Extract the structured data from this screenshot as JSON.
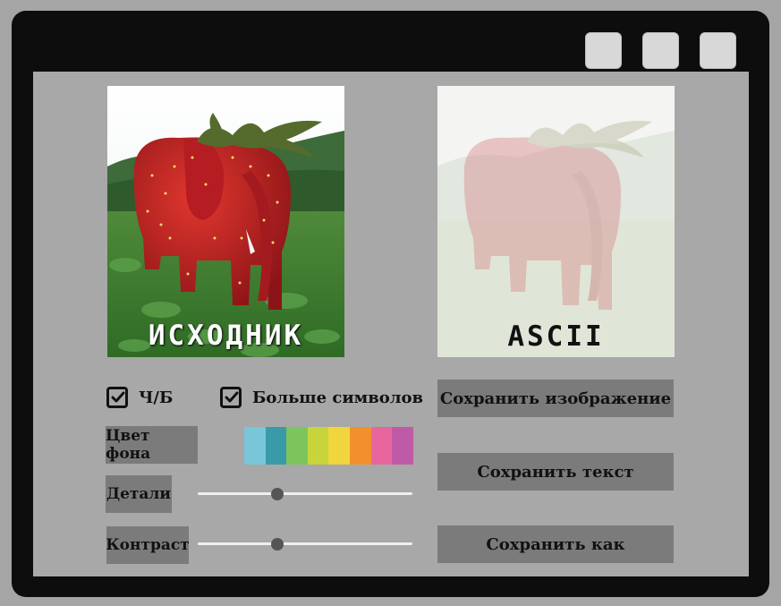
{
  "window": {
    "controls": [
      {
        "name": "minimize-button"
      },
      {
        "name": "maximize-button"
      },
      {
        "name": "close-button"
      }
    ]
  },
  "images": {
    "original_caption": "ИСХОДНИК",
    "ascii_caption": "ASCII"
  },
  "options": {
    "bw_label": "Ч/Б",
    "bw_checked": true,
    "more_symbols_label": "Больше символов",
    "more_symbols_checked": true
  },
  "controls": {
    "bg_color_label": "Цвет фона",
    "palette": [
      "#79c6d8",
      "#3a9aa8",
      "#7cc45c",
      "#c8d43c",
      "#f0d63c",
      "#f2902e",
      "#e8669e",
      "#bf5aa6"
    ],
    "details_label": "Детали",
    "details_value": 0.37,
    "contrast_label": "Контраст",
    "contrast_value": 0.37
  },
  "buttons": {
    "save_image": "Сохранить изображение",
    "save_text": "Сохранить текст",
    "save_as": "Сохранить как"
  }
}
